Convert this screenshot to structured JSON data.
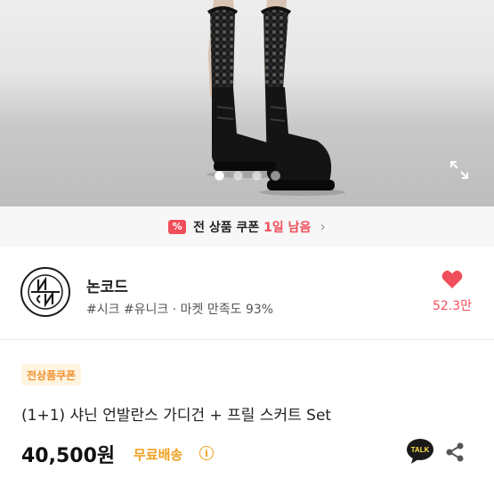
{
  "gallery": {
    "slide_count": 4,
    "active_slide": 1,
    "expand_icon": "expand-icon"
  },
  "coupon_bar": {
    "icon": "coupon-percent-icon",
    "icon_text": "%",
    "text": "전 상품 쿠폰",
    "days": "1일 남음",
    "chevron": "›"
  },
  "shop": {
    "name": "논코드",
    "tags": "#시크 #유니크 · 마켓 만족도 93%",
    "logo_icon": "shop-logo-icon",
    "like_icon": "heart-icon",
    "like_count": "52.3만"
  },
  "product": {
    "badge": "전상품쿠폰",
    "title": "(1+1) 샤닌 언발란스 가디건 + 프릴 스커트 Set",
    "price": "40,500원",
    "shipping": "무료배송",
    "info_icon_text": "i",
    "talk_icon": "talk-chat-icon",
    "talk_label": "TALK",
    "share_icon": "share-icon"
  },
  "colors": {
    "accent_red": "#f04e5a",
    "shipping_yellow": "#f0a020",
    "badge_orange": "#f0902c"
  }
}
